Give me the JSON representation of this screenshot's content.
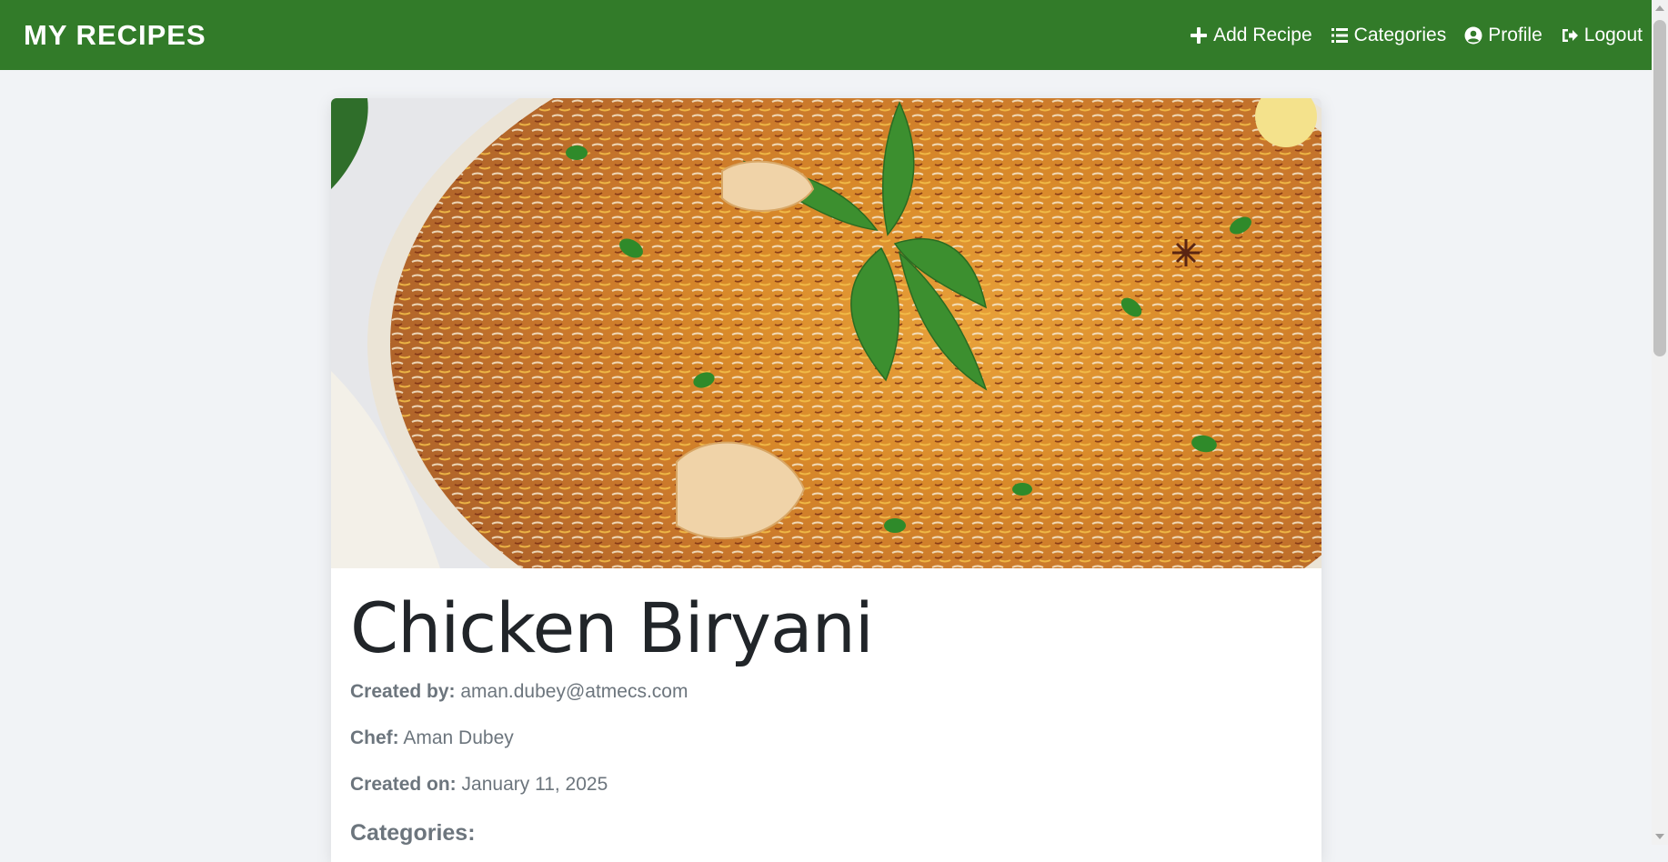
{
  "navbar": {
    "brand": "MY RECIPES",
    "links": [
      {
        "label": "Add Recipe",
        "icon": "plus-icon"
      },
      {
        "label": "Categories",
        "icon": "list-icon"
      },
      {
        "label": "Profile",
        "icon": "user-circle-icon"
      },
      {
        "label": "Logout",
        "icon": "sign-out-icon"
      }
    ],
    "color": "#327b29"
  },
  "recipe": {
    "title": "Chicken Biryani",
    "image_alt": "biryani-photo",
    "created_by_label": "Created by:",
    "created_by": "aman.dubey@atmecs.com",
    "chef_label": "Chef:",
    "chef": "Aman Dubey",
    "created_on_label": "Created on:",
    "created_on": "January 11, 2025",
    "categories_label": "Categories:"
  }
}
